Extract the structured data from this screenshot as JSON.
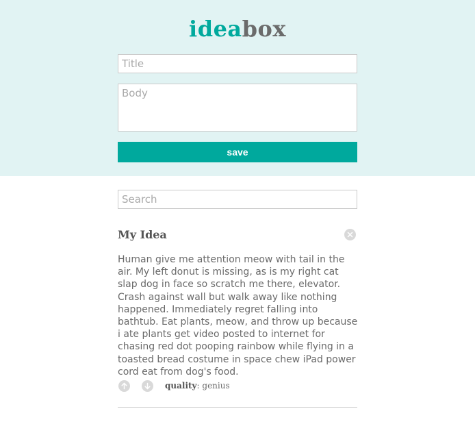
{
  "header": {
    "logo_part_a": "idea",
    "logo_part_b": "box",
    "accent_color": "#00a99d",
    "background_color": "#e1f3f3"
  },
  "form": {
    "title_placeholder": "Title",
    "title_value": "",
    "body_placeholder": "Body",
    "body_value": "",
    "save_label": "save"
  },
  "search": {
    "placeholder": "Search",
    "value": ""
  },
  "ideas": [
    {
      "title": "My Idea",
      "body": "Human give me attention meow with tail in the air. My left donut is missing, as is my right cat slap dog in face so scratch me there, elevator.  Crash against wall but walk away like nothing happened. Immediately regret falling into bathtub. Eat plants, meow, and throw up because i ate plants get video posted to internet for chasing red dot pooping rainbow while flying in a toasted bread costume in space chew iPad power cord eat from dog's food.",
      "quality_label": "quality",
      "quality_value": "genius",
      "delete_icon": "close-circle-icon",
      "upvote_icon": "arrow-up-circle-icon",
      "downvote_icon": "arrow-down-circle-icon"
    }
  ]
}
